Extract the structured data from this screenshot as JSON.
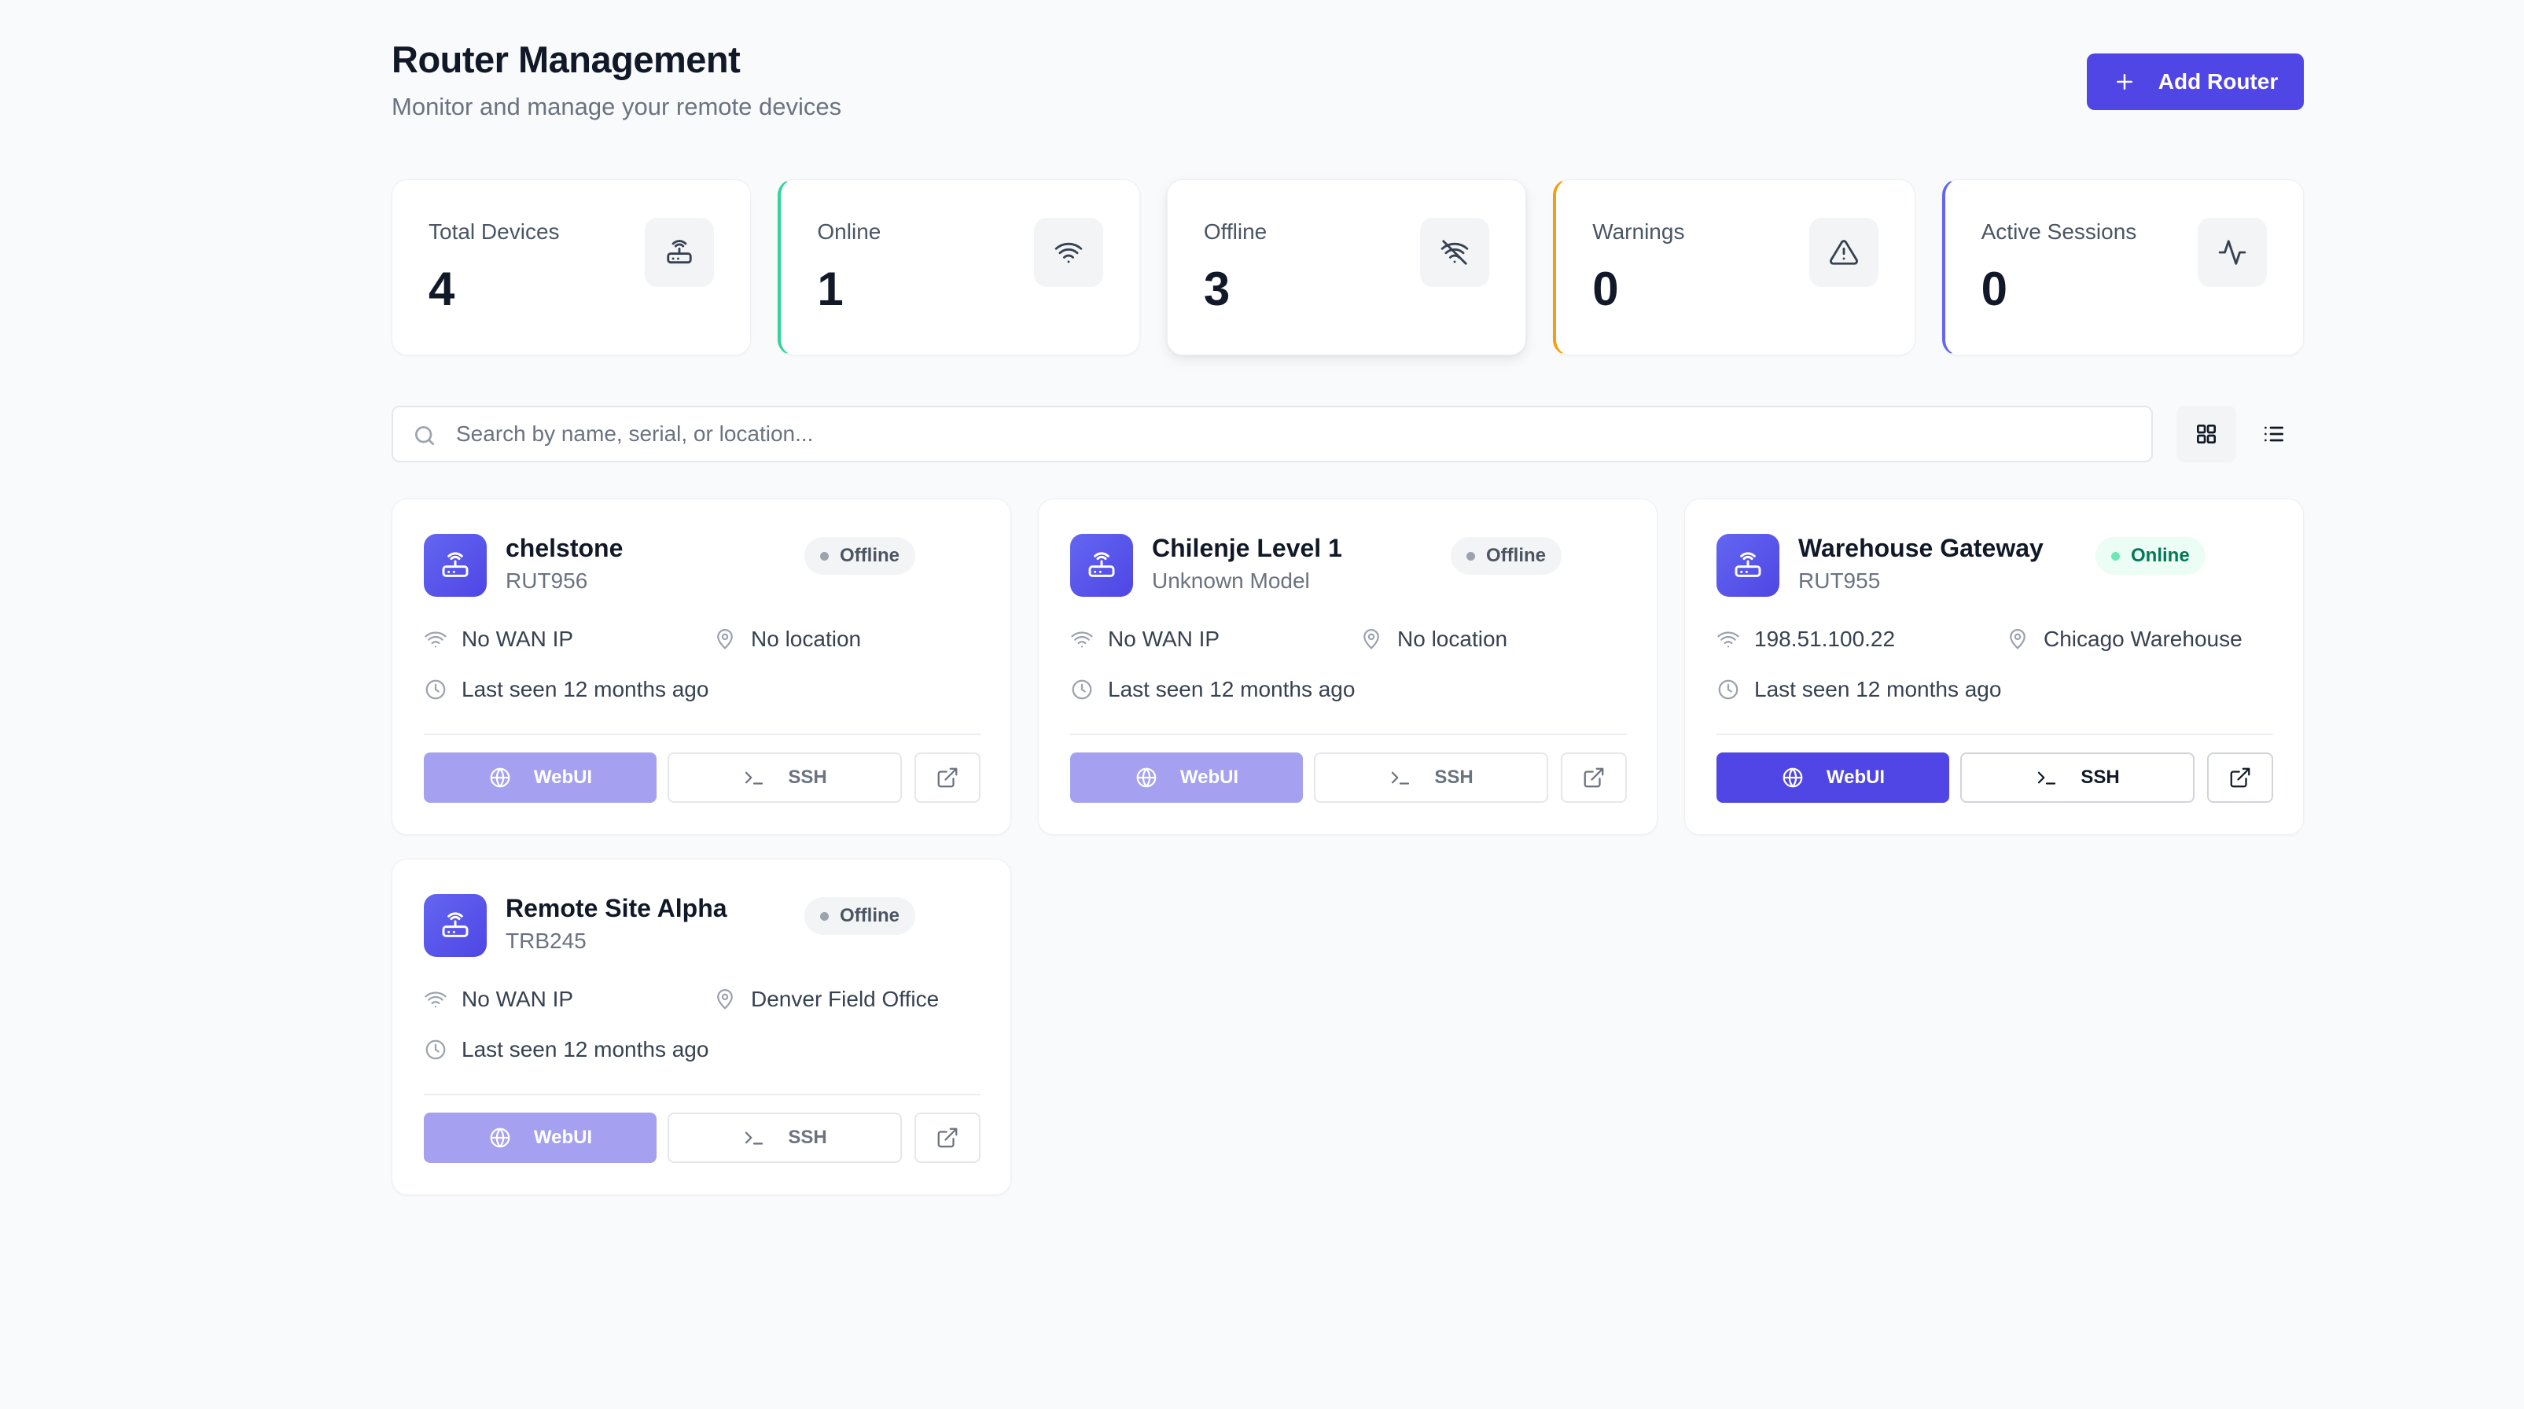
{
  "header": {
    "title": "Router Management",
    "subtitle": "Monitor and manage your remote devices",
    "add_button": "Add Router"
  },
  "stats": [
    {
      "label": "Total Devices",
      "value": "4",
      "icon": "router-icon"
    },
    {
      "label": "Online",
      "value": "1",
      "icon": "wifi-icon",
      "accent": "#34d399"
    },
    {
      "label": "Offline",
      "value": "3",
      "icon": "wifi-off-icon"
    },
    {
      "label": "Warnings",
      "value": "0",
      "icon": "warning-icon",
      "accent": "#f59e0b"
    },
    {
      "label": "Active Sessions",
      "value": "0",
      "icon": "activity-icon",
      "accent": "#6366f1"
    }
  ],
  "search": {
    "placeholder": "Search by name, serial, or location...",
    "value": ""
  },
  "view_toggle": {
    "selected": "grid"
  },
  "devices": [
    {
      "name": "chelstone",
      "model": "RUT956",
      "status": "Offline",
      "wan_ip": "No WAN IP",
      "location": "No location",
      "last_seen": "Last seen 12 months ago",
      "webui_label": "WebUI",
      "ssh_label": "SSH"
    },
    {
      "name": "Chilenje Level 1",
      "model": "Unknown Model",
      "status": "Offline",
      "wan_ip": "No WAN IP",
      "location": "No location",
      "last_seen": "Last seen 12 months ago",
      "webui_label": "WebUI",
      "ssh_label": "SSH"
    },
    {
      "name": "Warehouse Gateway",
      "model": "RUT955",
      "status": "Online",
      "wan_ip": "198.51.100.22",
      "location": "Chicago Warehouse",
      "last_seen": "Last seen 12 months ago",
      "webui_label": "WebUI",
      "ssh_label": "SSH"
    },
    {
      "name": "Remote Site Alpha",
      "model": "TRB245",
      "status": "Offline",
      "wan_ip": "No WAN IP",
      "location": "Denver Field Office",
      "last_seen": "Last seen 12 months ago",
      "webui_label": "WebUI",
      "ssh_label": "SSH"
    }
  ],
  "colors": {
    "primary": "#4f46e5",
    "primary_disabled": "#a5a1f0",
    "online": "#047857",
    "offline": "#4b5563",
    "background": "#f9fafb"
  }
}
